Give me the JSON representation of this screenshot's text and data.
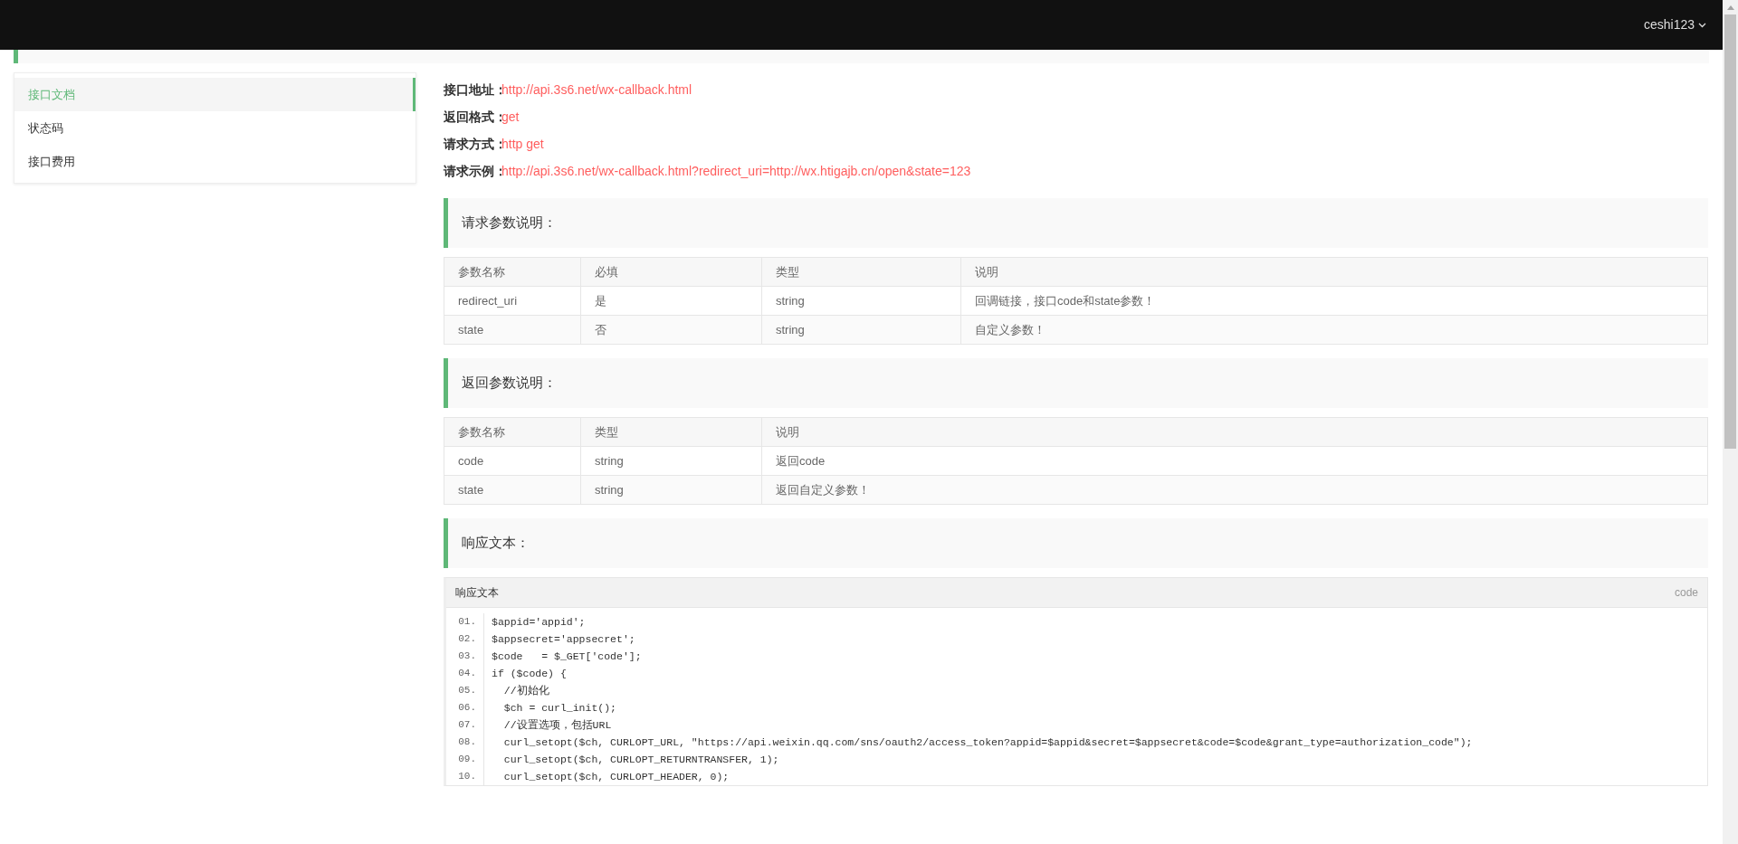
{
  "header": {
    "user": "ceshi123"
  },
  "sidebar": {
    "items": [
      {
        "label": "接口文档",
        "selected": true
      },
      {
        "label": "状态码",
        "selected": false
      },
      {
        "label": "接口费用",
        "selected": false
      }
    ]
  },
  "info": [
    {
      "label": "接口地址：",
      "value": "http://api.3s6.net/wx-callback.html"
    },
    {
      "label": "返回格式：",
      "value": "get"
    },
    {
      "label": "请求方式：",
      "value": "http get"
    },
    {
      "label": "请求示例：",
      "value": "http://api.3s6.net/wx-callback.html?redirect_uri=http://wx.htigajb.cn/open&state=123"
    }
  ],
  "sections": [
    {
      "kind": "table",
      "title": "请求参数说明：",
      "columns": [
        "参数名称",
        "必填",
        "类型",
        "说明"
      ],
      "rows": [
        [
          "redirect_uri",
          "是",
          "string",
          "回调链接，接口code和state参数！"
        ],
        [
          "state",
          "否",
          "string",
          "自定义参数！"
        ]
      ]
    },
    {
      "kind": "table",
      "title": "返回参数说明：",
      "columns": [
        "参数名称",
        "类型",
        "说明"
      ],
      "rows": [
        [
          "code",
          "string",
          "返回code"
        ],
        [
          "state",
          "string",
          "返回自定义参数！"
        ]
      ]
    },
    {
      "kind": "code",
      "title": "响应文本：",
      "code_title": "响应文本",
      "code_lang": "code",
      "lines": [
        {
          "number": "01.",
          "text": "$appid='appid';"
        },
        {
          "number": "02.",
          "text": "$appsecret='appsecret';"
        },
        {
          "number": "03.",
          "text": "$code   = $_GET['code'];"
        },
        {
          "number": "04.",
          "text": "if ($code) {"
        },
        {
          "number": "05.",
          "text": "  //初始化"
        },
        {
          "number": "06.",
          "text": "  $ch = curl_init();"
        },
        {
          "number": "07.",
          "text": "  //设置选项，包括URL"
        },
        {
          "number": "08.",
          "text": "  curl_setopt($ch, CURLOPT_URL, \"https://api.weixin.qq.com/sns/oauth2/access_token?appid=$appid&secret=$appsecret&code=$code&grant_type=authorization_code\");"
        },
        {
          "number": "09.",
          "text": "  curl_setopt($ch, CURLOPT_RETURNTRANSFER, 1);"
        },
        {
          "number": "10.",
          "text": "  curl_setopt($ch, CURLOPT_HEADER, 0);"
        }
      ]
    }
  ]
}
